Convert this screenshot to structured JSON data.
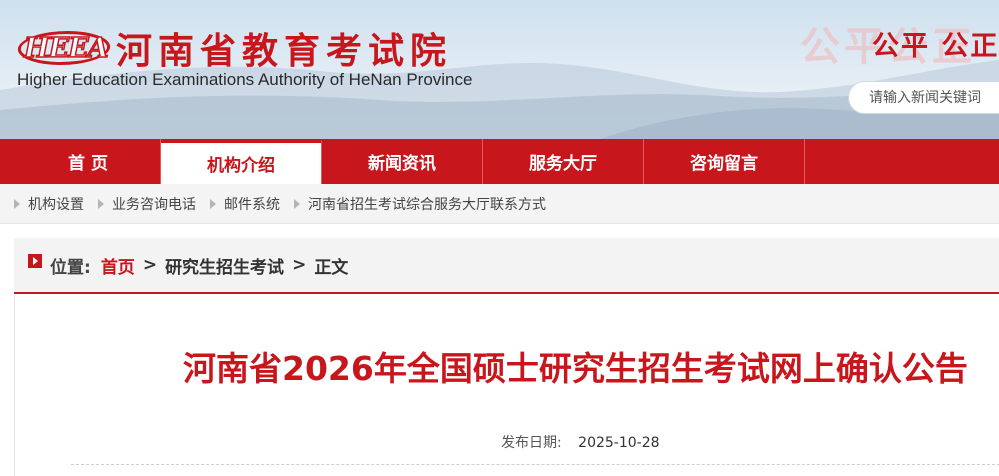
{
  "header": {
    "logo_letters": "HEEA",
    "site_name_cn": "河南省教育考试院",
    "site_name_en": "Higher Education Examinations Authority of HeNan Province",
    "motto_ghost": "公平公正",
    "motto_front": "公平 公正",
    "search_placeholder": "请输入新闻关键词"
  },
  "nav": {
    "items": [
      {
        "label": "首 页"
      },
      {
        "label": "机构介绍"
      },
      {
        "label": "新闻资讯"
      },
      {
        "label": "服务大厅"
      },
      {
        "label": "咨询留言"
      }
    ],
    "active_index": 1
  },
  "sublinks": [
    {
      "label": "机构设置"
    },
    {
      "label": "业务咨询电话"
    },
    {
      "label": "邮件系统"
    },
    {
      "label": "河南省招生考试综合服务大厅联系方式"
    }
  ],
  "breadcrumb": {
    "label": "位置:",
    "home": "首页",
    "separator": ">",
    "section": "研究生招生考试",
    "current": "正文"
  },
  "article": {
    "title": "河南省2026年全国硕士研究生招生考试网上确认公告",
    "date_label": "发布日期:",
    "date_value": "2025-10-28"
  },
  "colors": {
    "brand_red": "#c8161d",
    "nav_text": "#ffffff"
  },
  "icons": [
    "search-icon",
    "breadcrumb-arrow-icon",
    "sublink-arrow-icon"
  ]
}
